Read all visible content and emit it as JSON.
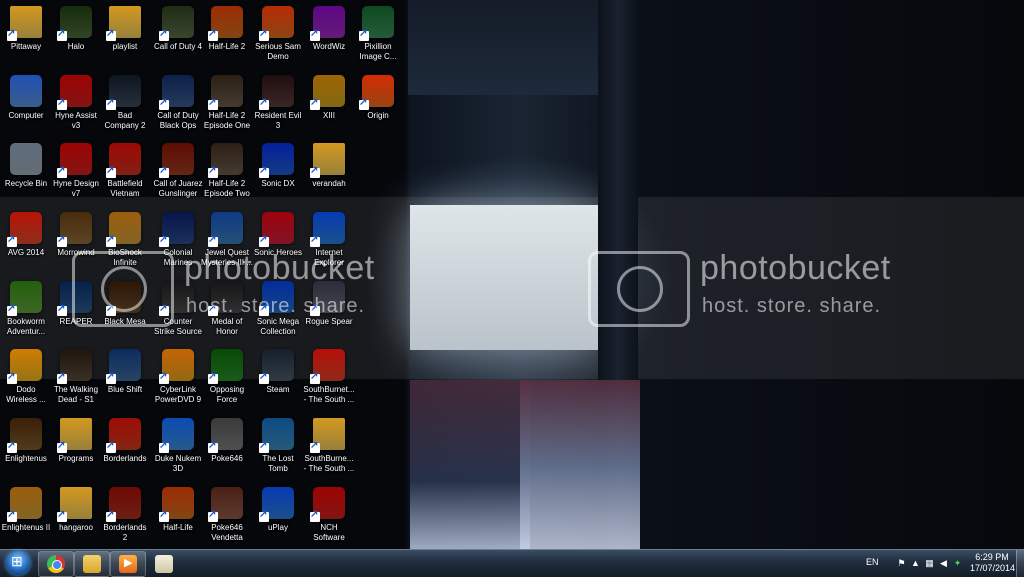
{
  "watermark": {
    "title": "photobucket",
    "tagline": "host. store. share."
  },
  "icons": [
    {
      "label": "Pittaway",
      "icon": "folder-icon",
      "color": "#e8c55a"
    },
    {
      "label": "Computer",
      "icon": "computer-icon",
      "color": "#5a8fd6"
    },
    {
      "label": "Recycle Bin",
      "icon": "recycle-bin-icon",
      "color": "#9aa6b2"
    },
    {
      "label": "AVG 2014",
      "icon": "avg-icon",
      "color": "#d8472a"
    },
    {
      "label": "Bookworm\nAdventur...",
      "icon": "bookworm-icon",
      "color": "#5e9c3a"
    },
    {
      "label": "Dodo\nWireless ...",
      "icon": "dodo-icon",
      "color": "#e6b21e"
    },
    {
      "label": "Enlightenus",
      "icon": "enlightenus-icon",
      "color": "#7a5a2a"
    },
    {
      "label": "Enlightenus II",
      "icon": "enlightenus-ii-icon",
      "color": "#c79a3a"
    },
    {
      "label": "Halo",
      "icon": "halo-icon",
      "color": "#4a6a3a"
    },
    {
      "label": "Hyne Assist\nv3",
      "icon": "hyne-assist-icon",
      "color": "#c8201e"
    },
    {
      "label": "Hyne Design\nv7",
      "icon": "hyne-design-icon",
      "color": "#c8201e"
    },
    {
      "label": "Morrowind",
      "icon": "morrowind-icon",
      "color": "#8a6a3a"
    },
    {
      "label": "REAPER",
      "icon": "reaper-icon",
      "color": "#2a5a8a"
    },
    {
      "label": "The Walking\nDead - S1",
      "icon": "walking-dead-icon",
      "color": "#5a4a3a"
    },
    {
      "label": "Programs",
      "icon": "folder-icon",
      "color": "#e8c55a"
    },
    {
      "label": "hangaroo",
      "icon": "folder-icon",
      "color": "#e8c55a"
    },
    {
      "label": "playlist",
      "icon": "folder-icon",
      "color": "#e8c55a"
    },
    {
      "label": "Bad\nCompany 2",
      "icon": "bad-company-icon",
      "color": "#3a4a5a"
    },
    {
      "label": "Battlefield\nVietnam",
      "icon": "battlefield-icon",
      "color": "#c8301e"
    },
    {
      "label": "BioShock\nInfinite",
      "icon": "bioshock-icon",
      "color": "#c89a3a"
    },
    {
      "label": "Black Mesa",
      "icon": "black-mesa-icon",
      "color": "#6a4a2a"
    },
    {
      "label": "Blue Shift",
      "icon": "blue-shift-icon",
      "color": "#3a6a9a"
    },
    {
      "label": "Borderlands",
      "icon": "borderlands-icon",
      "color": "#c83a1e"
    },
    {
      "label": "Borderlands\n2",
      "icon": "borderlands-2-icon",
      "color": "#a8301e"
    },
    {
      "label": "Call of Duty 4",
      "icon": "cod4-icon",
      "color": "#5a6a4a"
    },
    {
      "label": "Call of Duty\nBlack Ops",
      "icon": "black-ops-icon",
      "color": "#3a5a8a"
    },
    {
      "label": "Call of Juarez\nGunslinger",
      "icon": "juarez-icon",
      "color": "#9a3a1e"
    },
    {
      "label": "Colonial\nMarines",
      "icon": "colonial-marines-icon",
      "color": "#2a4a8a"
    },
    {
      "label": "Counter\nStrike Source",
      "icon": "counter-strike-icon",
      "color": "#4a4a4a"
    },
    {
      "label": "CyberLink\nPowerDVD 9",
      "icon": "powerdvd-icon",
      "color": "#e0a020"
    },
    {
      "label": "Duke Nukem\n3D",
      "icon": "duke-nukem-icon",
      "color": "#3a8ad6"
    },
    {
      "label": "Half-Life",
      "icon": "half-life-icon",
      "color": "#c86a1e"
    },
    {
      "label": "Half-Life 2",
      "icon": "half-life-2-icon",
      "color": "#c86a1e"
    },
    {
      "label": "Half-Life 2\nEpisode One",
      "icon": "hl2-ep1-icon",
      "color": "#6a5a4a"
    },
    {
      "label": "Half-Life 2\nEpisode Two",
      "icon": "hl2-ep2-icon",
      "color": "#6a5a4a"
    },
    {
      "label": "Jewel Quest\nMysteries III ...",
      "icon": "jewel-quest-icon",
      "color": "#3a7ab8"
    },
    {
      "label": "Medal of\nHonor",
      "icon": "medal-of-honor-icon",
      "color": "#4a4a4a"
    },
    {
      "label": "Opposing\nForce",
      "icon": "opposing-force-icon",
      "color": "#2a8a2a"
    },
    {
      "label": "Poke646",
      "icon": "poke646-icon",
      "color": "#7a7a7a"
    },
    {
      "label": "Poke646\nVendetta",
      "icon": "poke646-vendetta-icon",
      "color": "#8a5a4a"
    },
    {
      "label": "Serious Sam\nDemo",
      "icon": "serious-sam-icon",
      "color": "#d86a1e"
    },
    {
      "label": "Resident Evil\n3",
      "icon": "resident-evil-icon",
      "color": "#5a3a3a"
    },
    {
      "label": "Sonic DX",
      "icon": "sonic-dx-icon",
      "color": "#1e5ac8"
    },
    {
      "label": "Sonic Heroes",
      "icon": "sonic-heroes-icon",
      "color": "#c81e3a"
    },
    {
      "label": "Sonic Mega\nCollection",
      "icon": "sonic-mega-icon",
      "color": "#1e6ac8"
    },
    {
      "label": "Steam",
      "icon": "steam-icon",
      "color": "#4a5a6a"
    },
    {
      "label": "The Lost\nTomb",
      "icon": "lost-tomb-icon",
      "color": "#3a8ab8"
    },
    {
      "label": "uPlay",
      "icon": "uplay-icon",
      "color": "#2a7ad6"
    },
    {
      "label": "WordWiz",
      "icon": "wordwiz-icon",
      "color": "#9a2ab8"
    },
    {
      "label": "XIII",
      "icon": "xiii-icon",
      "color": "#c8a01e"
    },
    {
      "label": "verandah",
      "icon": "folder-icon",
      "color": "#e8c55a"
    },
    {
      "label": "Internet\nExplorer",
      "icon": "internet-explorer-icon",
      "color": "#2a7ad6"
    },
    {
      "label": "Rogue Spear",
      "icon": "rogue-spear-icon",
      "color": "#6a6a7a"
    },
    {
      "label": "SouthBurnet...\n- The South ...",
      "icon": "chrome-icon",
      "color": "#d8402a"
    },
    {
      "label": "SouthBurne...\n- The South ...",
      "icon": "folder-icon",
      "color": "#e8c55a"
    },
    {
      "label": "NCH\nSoftware",
      "icon": "nch-icon",
      "color": "#c8201e"
    },
    {
      "label": "Pixillion\nImage C...",
      "icon": "pixillion-icon",
      "color": "#3a8a5a"
    },
    {
      "label": "Origin",
      "icon": "origin-icon",
      "color": "#e86a1e"
    }
  ],
  "taskbar": {
    "apps": [
      {
        "name": "Google Chrome",
        "icon": "chrome-icon"
      },
      {
        "name": "Windows Explorer",
        "icon": "explorer-folder-icon"
      },
      {
        "name": "Media Player",
        "icon": "media-player-icon"
      },
      {
        "name": "Files",
        "icon": "files-icon"
      }
    ],
    "tray": {
      "language": "EN",
      "time": "6:29 PM",
      "date": "17/07/2014"
    }
  }
}
